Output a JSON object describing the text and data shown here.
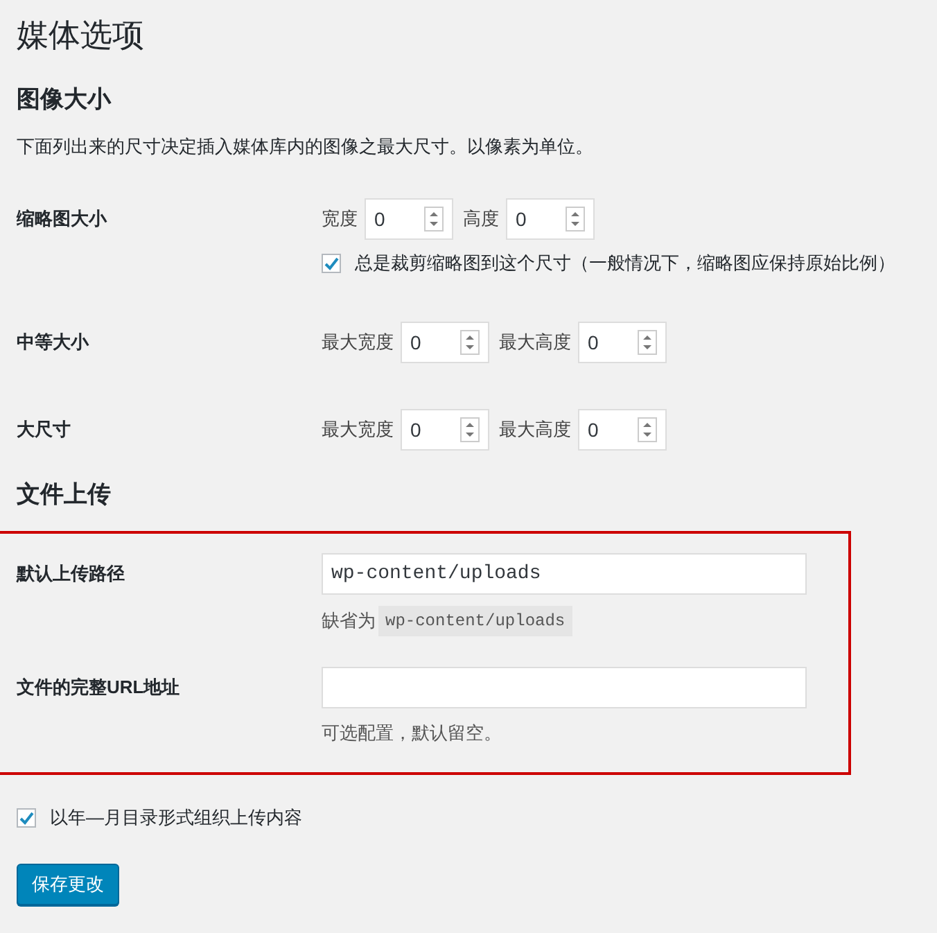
{
  "page_title": "媒体选项",
  "sections": [
    {
      "heading": "图像大小",
      "highlighted": false,
      "description": "下面列出来的尺寸决定插入媒体库内的图像之最大尺寸。以像素为单位。",
      "rows": [
        {
          "kind": "size",
          "label": "缩略图大小",
          "fields": [
            {
              "label": "宽度",
              "value": "0"
            },
            {
              "label": "高度",
              "value": "0"
            }
          ],
          "option": {
            "label": "总是裁剪缩略图到这个尺寸（一般情况下，缩略图应保持原始比例）",
            "checked": true
          }
        },
        {
          "kind": "size",
          "label": "中等大小",
          "fields": [
            {
              "label": "最大宽度",
              "value": "0"
            },
            {
              "label": "最大高度",
              "value": "0"
            }
          ]
        },
        {
          "kind": "size",
          "label": "大尺寸",
          "fields": [
            {
              "label": "最大宽度",
              "value": "0"
            },
            {
              "label": "最大高度",
              "value": "0"
            }
          ]
        }
      ]
    },
    {
      "heading": "文件上传",
      "highlighted": true,
      "rows": [
        {
          "kind": "text",
          "label": "默认上传路径",
          "value": "wp-content/uploads",
          "hint": "缺省为",
          "hint_code": "wp-content/uploads"
        },
        {
          "kind": "text",
          "label": "文件的完整URL地址",
          "hint": "可选配置，默认留空。"
        }
      ]
    }
  ],
  "organize_option": {
    "label": "以年—月目录形式组织上传内容",
    "checked": true
  },
  "save_button": "保存更改"
}
